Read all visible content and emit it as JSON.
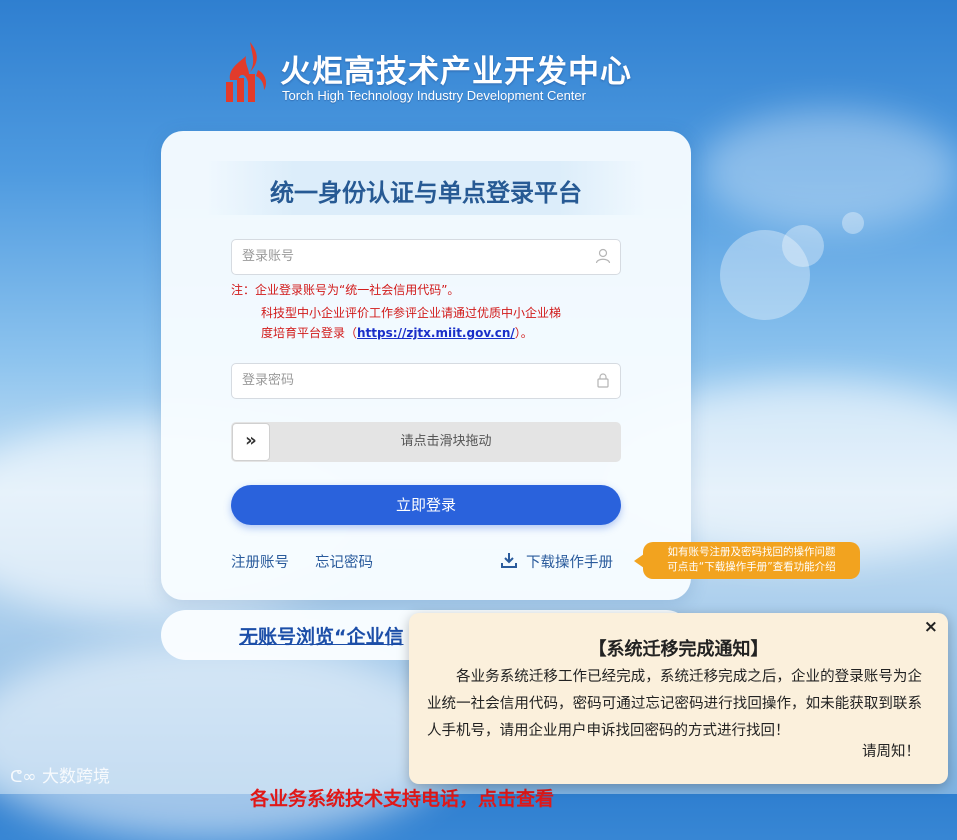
{
  "header": {
    "title_cn": "火炬高技术产业开发中心",
    "title_en": "Torch High Technology Industry Development Center"
  },
  "login": {
    "title": "统一身份认证与单点登录平台",
    "account_placeholder": "登录账号",
    "note_line1": "注：企业登录账号为“统一社会信用代码”。",
    "note_line2": "科技型中小企业评价工作参评企业请通过优质中小企业梯",
    "note_line3_prefix": "度培育平台登录（",
    "note_link": "https://zjtx.miit.gov.cn/",
    "note_line3_suffix": "）。",
    "password_placeholder": "登录密码",
    "slider_text": "请点击滑块拖动",
    "slider_handle": "»",
    "login_button": "立即登录",
    "register_link": "注册账号",
    "forgot_link": "忘记密码",
    "download_link": "下载操作手册"
  },
  "tooltip": {
    "line1": "如有账号注册及密码找回的操作问题",
    "line2": "可点击“下载操作手册”查看功能介绍"
  },
  "browse": {
    "text": "无账号浏览“企业信"
  },
  "notice": {
    "close": "×",
    "title": "【系统迁移完成通知】",
    "body": "各业务系统迁移工作已经完成，系统迁移完成之后，企业的登录账号为企业统一社会信用代码，密码可通过忘记密码进行找回操作，如未能获取到联系人手机号，请用企业用户申诉找回密码的方式进行找回！",
    "sign": "请周知！"
  },
  "footer": {
    "watermark": "大数跨境",
    "red_banner": "各业务系统技术支持电话，点击查看"
  },
  "colors": {
    "primary": "#2a62dc",
    "title": "#275a94",
    "warning": "#d11a1a",
    "tooltip": "#f2a31f",
    "notice_bg": "#fbf0dc"
  }
}
